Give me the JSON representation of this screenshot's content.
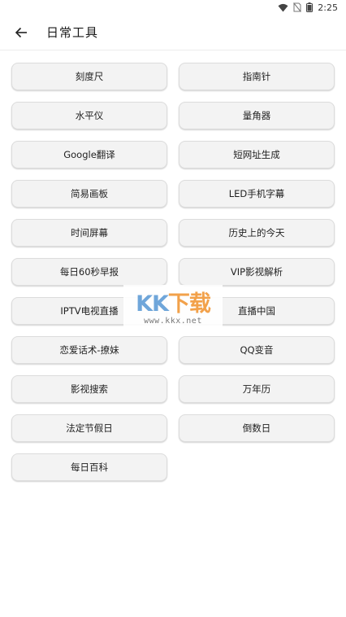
{
  "status_bar": {
    "time": "2:25"
  },
  "app_bar": {
    "title": "日常工具"
  },
  "tools": [
    "刻度尺",
    "指南针",
    "水平仪",
    "量角器",
    "Google翻译",
    "短网址生成",
    "简易画板",
    "LED手机字幕",
    "时间屏幕",
    "历史上的今天",
    "每日60秒早报",
    "VIP影视解析",
    "IPTV电视直播",
    "直播中国",
    "恋爱话术-撩妹",
    "QQ变音",
    "影视搜索",
    "万年历",
    "法定节假日",
    "倒数日",
    "每日百科"
  ],
  "watermark": {
    "logo_main": "KK",
    "logo_accent": "下载",
    "url": "www.kkx.net"
  },
  "colors": {
    "button_bg": "#f3f3f3",
    "button_border": "#dcdcdc",
    "watermark_blue": "#6fa6da",
    "watermark_orange": "#f2a14a"
  }
}
